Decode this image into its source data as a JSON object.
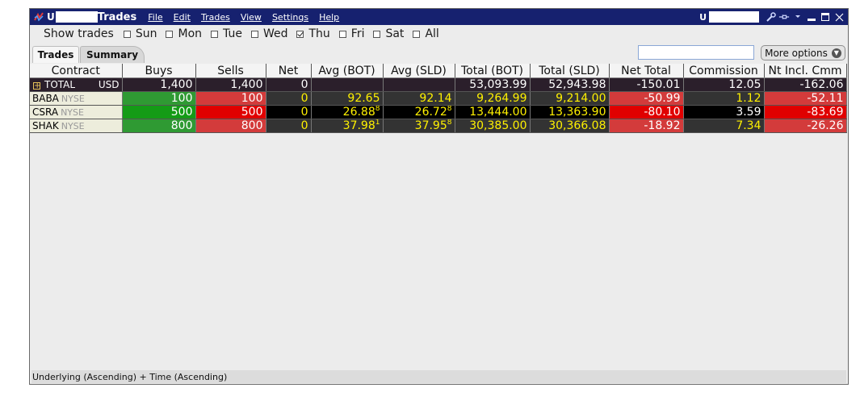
{
  "window": {
    "title_prefix": "U",
    "title": "Trades",
    "menu": [
      "File",
      "Edit",
      "Trades",
      "View",
      "Settings",
      "Help"
    ],
    "account_prefix": "U"
  },
  "filter": {
    "label": "Show trades",
    "days": [
      {
        "label": "Sun",
        "checked": false
      },
      {
        "label": "Mon",
        "checked": false
      },
      {
        "label": "Tue",
        "checked": false
      },
      {
        "label": "Wed",
        "checked": false
      },
      {
        "label": "Thu",
        "checked": true
      },
      {
        "label": "Fri",
        "checked": false
      },
      {
        "label": "Sat",
        "checked": false
      },
      {
        "label": "All",
        "checked": false
      }
    ]
  },
  "tabs": {
    "trades": "Trades",
    "summary": "Summary"
  },
  "search": {
    "value": ""
  },
  "more_options": "More options",
  "columns": [
    "Contract",
    "Buys",
    "Sells",
    "Net",
    "Avg (BOT)",
    "Avg (SLD)",
    "Total (BOT)",
    "Total (SLD)",
    "Net Total",
    "Commission",
    "Nt Incl. Cmm"
  ],
  "total_row": {
    "label": "TOTAL",
    "currency": "USD",
    "buys": "1,400",
    "sells": "1,400",
    "net": "0",
    "avg_bot": "",
    "avg_sld": "",
    "total_bot": "53,093.99",
    "total_sld": "52,943.98",
    "net_total": "-150.01",
    "commission": "12.05",
    "nt_incl_cmm": "-162.06"
  },
  "rows": [
    {
      "symbol": "BABA",
      "exchange": "NYSE",
      "buys": "100",
      "sells": "100",
      "net": "0",
      "avg_bot": "92.65",
      "avg_bot_sup": "",
      "avg_sld": "92.14",
      "avg_sld_sup": "",
      "total_bot": "9,264.99",
      "total_sld": "9,214.00",
      "net_total": "-50.99",
      "commission": "1.12",
      "nt_incl_cmm": "-52.11"
    },
    {
      "symbol": "CSRA",
      "exchange": "NYSE",
      "buys": "500",
      "sells": "500",
      "net": "0",
      "avg_bot": "26.88",
      "avg_bot_sup": "8",
      "avg_sld": "26.72",
      "avg_sld_sup": "8",
      "total_bot": "13,444.00",
      "total_sld": "13,363.90",
      "net_total": "-80.10",
      "commission": "3.59",
      "nt_incl_cmm": "-83.69"
    },
    {
      "symbol": "SHAK",
      "exchange": "NYSE",
      "buys": "800",
      "sells": "800",
      "net": "0",
      "avg_bot": "37.98",
      "avg_bot_sup": "1",
      "avg_sld": "37.95",
      "avg_sld_sup": "8",
      "total_bot": "30,385.00",
      "total_sld": "30,366.08",
      "net_total": "-18.92",
      "commission": "7.34",
      "nt_incl_cmm": "-26.26"
    }
  ],
  "status": "Underlying (Ascending)  +  Time (Ascending)",
  "colors": {
    "titlebar": "#16216f",
    "buy": "#2f9a33",
    "sell": "#d33b3b",
    "value_text": "#fff100"
  }
}
